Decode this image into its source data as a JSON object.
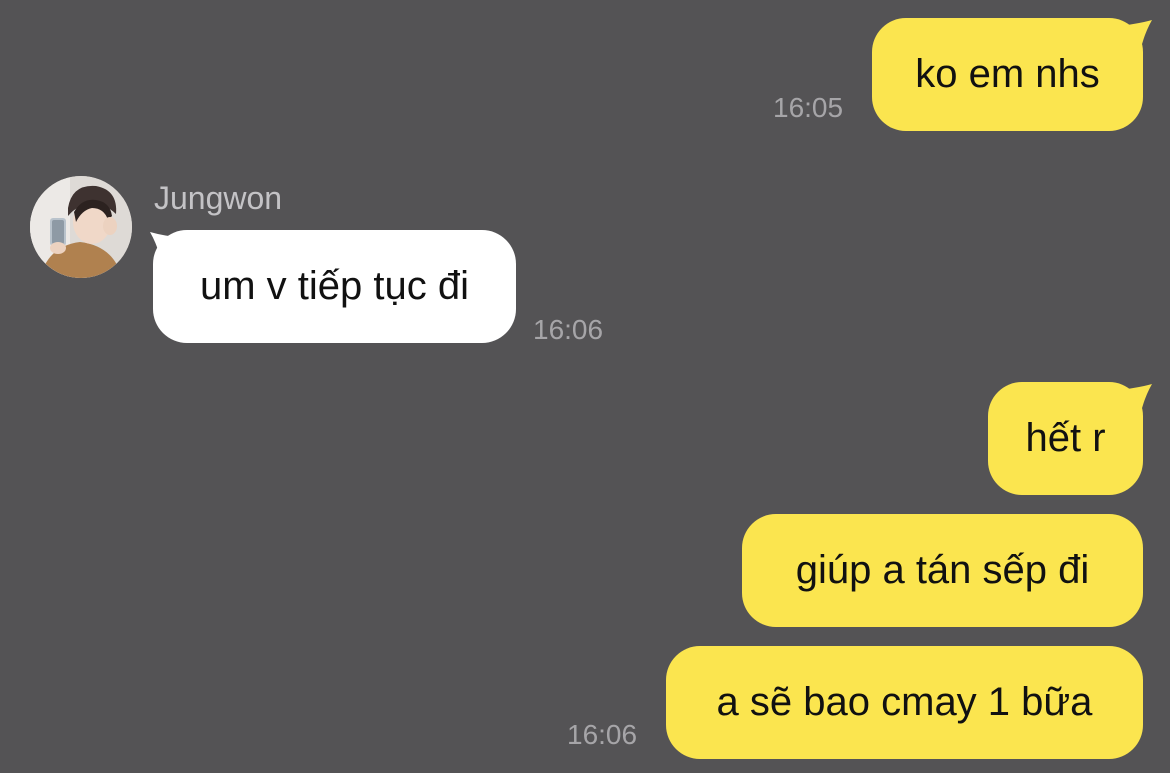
{
  "colors": {
    "background": "#545355",
    "outgoing_bubble": "#fbe54f",
    "incoming_bubble": "#ffffff",
    "timestamp_text": "#a6a5a8",
    "sender_name_text": "#c4c3c6"
  },
  "messages": [
    {
      "direction": "outgoing",
      "text": "ko em nhs",
      "time": "16:05"
    },
    {
      "direction": "incoming",
      "sender": "Jungwon",
      "avatar_icon": "profile-photo",
      "text": "um v tiếp tục đi",
      "time": "16:06"
    },
    {
      "direction": "outgoing",
      "text": "hết r",
      "time": ""
    },
    {
      "direction": "outgoing",
      "text": "giúp a tán sếp đi",
      "time": ""
    },
    {
      "direction": "outgoing",
      "text": "a sẽ bao cmay 1 bữa",
      "time": "16:06"
    }
  ]
}
